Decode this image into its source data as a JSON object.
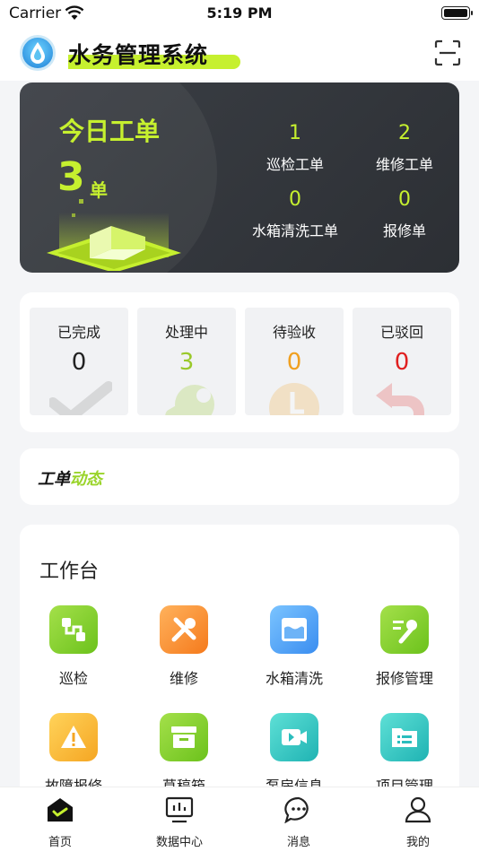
{
  "status_bar": {
    "carrier": "Carrier",
    "time": "5:19 PM"
  },
  "header": {
    "title": "水务管理系统"
  },
  "orders": {
    "title": "今日工单",
    "count": "3",
    "unit": "单",
    "stats": [
      {
        "num": "1",
        "label": "巡检工单"
      },
      {
        "num": "2",
        "label": "维修工单"
      },
      {
        "num": "0",
        "label": "水箱清洗工单"
      },
      {
        "num": "0",
        "label": "报修单"
      }
    ]
  },
  "status_tiles": [
    {
      "label": "已完成",
      "value": "0",
      "color": "#222222"
    },
    {
      "label": "处理中",
      "value": "3",
      "color": "#9ac92a"
    },
    {
      "label": "待验收",
      "value": "0",
      "color": "#f0a020"
    },
    {
      "label": "已驳回",
      "value": "0",
      "color": "#e02020"
    }
  ],
  "dynamics": {
    "title_a": "工单",
    "title_b": "动态"
  },
  "workbench": {
    "title": "工作台",
    "apps": [
      {
        "label": "巡检",
        "icon": "route-icon"
      },
      {
        "label": "维修",
        "icon": "tools-icon"
      },
      {
        "label": "水箱清洗",
        "icon": "water-tank-icon"
      },
      {
        "label": "报修管理",
        "icon": "wrench-doc-icon"
      },
      {
        "label": "故障报修",
        "icon": "warning-icon"
      },
      {
        "label": "草稿箱",
        "icon": "archive-box-icon"
      },
      {
        "label": "泵房信息",
        "icon": "video-icon"
      },
      {
        "label": "项目管理",
        "icon": "folder-icon"
      }
    ]
  },
  "tabs": [
    {
      "label": "首页",
      "icon": "home-icon",
      "active": true
    },
    {
      "label": "数据中心",
      "icon": "monitor-chart-icon",
      "active": false
    },
    {
      "label": "消息",
      "icon": "message-icon",
      "active": false
    },
    {
      "label": "我的",
      "icon": "user-icon",
      "active": false
    }
  ]
}
